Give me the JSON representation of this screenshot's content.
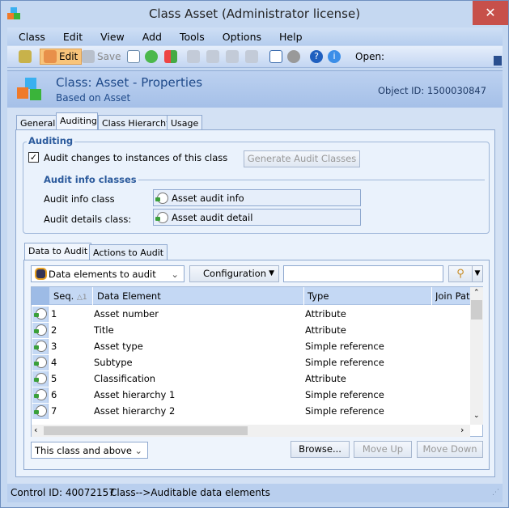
{
  "window": {
    "title": "Class Asset (Administrator license)",
    "close": "✕"
  },
  "menu": [
    "Class",
    "Edit",
    "View",
    "Add",
    "Tools",
    "Options",
    "Help"
  ],
  "toolbar": {
    "edit": "Edit",
    "save": "Save",
    "open_label": "Open:"
  },
  "header": {
    "title": "Class: Asset - Properties",
    "subtitle": "Based on Asset",
    "object_id": "Object ID: 1500030847"
  },
  "tabs": [
    "General",
    "Auditing",
    "Class Hierarchy",
    "Usage"
  ],
  "auditing": {
    "group_title": "Auditing",
    "checkbox_label": "Audit changes to instances of this class",
    "checked": true,
    "generate_button": "Generate Audit Classes",
    "info_title": "Audit info classes",
    "info_class_label": "Audit info class",
    "info_class_value": "Asset audit info",
    "details_class_label": "Audit details class:",
    "details_class_value": "Asset audit detail"
  },
  "subtabs": [
    "Data to Audit",
    "Actions to Audit"
  ],
  "filter": {
    "dropdown": "Data elements to audit",
    "config": "Configuration",
    "search": ""
  },
  "grid": {
    "columns": [
      "Seq.",
      "Data Element",
      "Type",
      "Join Path"
    ],
    "sort_indicator": "△1",
    "rows": [
      [
        "1",
        "Asset number",
        "Attribute"
      ],
      [
        "2",
        "Title",
        "Attribute"
      ],
      [
        "3",
        "Asset type",
        "Simple reference"
      ],
      [
        "4",
        "Subtype",
        "Simple reference"
      ],
      [
        "5",
        "Classification",
        "Attribute"
      ],
      [
        "6",
        "Asset hierarchy 1",
        "Simple reference"
      ],
      [
        "7",
        "Asset hierarchy 2",
        "Simple reference"
      ]
    ]
  },
  "bottom": {
    "scope": "This class and above",
    "browse": "Browse...",
    "move_up": "Move Up",
    "move_down": "Move Down"
  },
  "status": {
    "control_id": "Control ID: 40072157",
    "path": "Class-->Auditable data elements"
  }
}
